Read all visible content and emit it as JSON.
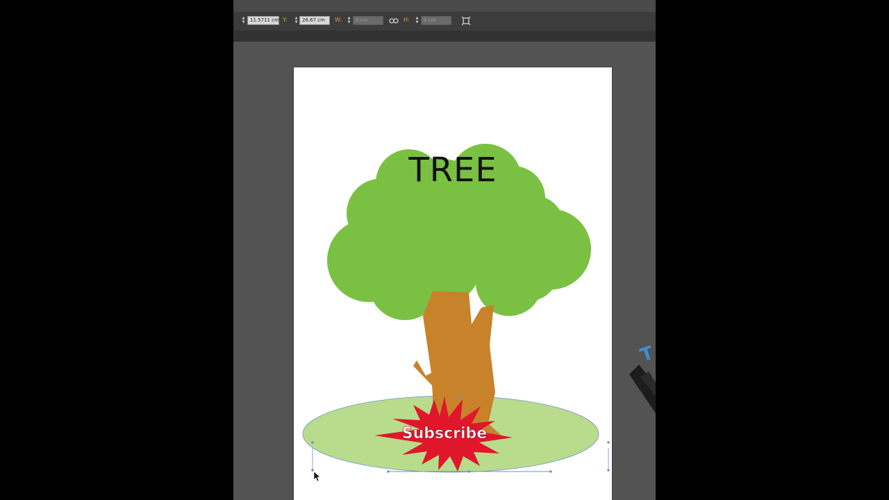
{
  "control_bar": {
    "x_value": "11.5711 cm",
    "y_label": "Y:",
    "y_value": "26.67 cm",
    "w_label": "W:",
    "w_value": "0 cm",
    "h_label": "H:",
    "h_value": "0 cm"
  },
  "artboard": {
    "title": "TREE"
  },
  "badge": {
    "label": "Subscribe"
  },
  "colors": {
    "canopy": "#7ac143",
    "trunk": "#c8822a",
    "ground": "#b8dc8c",
    "badge": "#e0162b",
    "selection": "#6a8fd0",
    "accent": "#3b8fd4"
  }
}
